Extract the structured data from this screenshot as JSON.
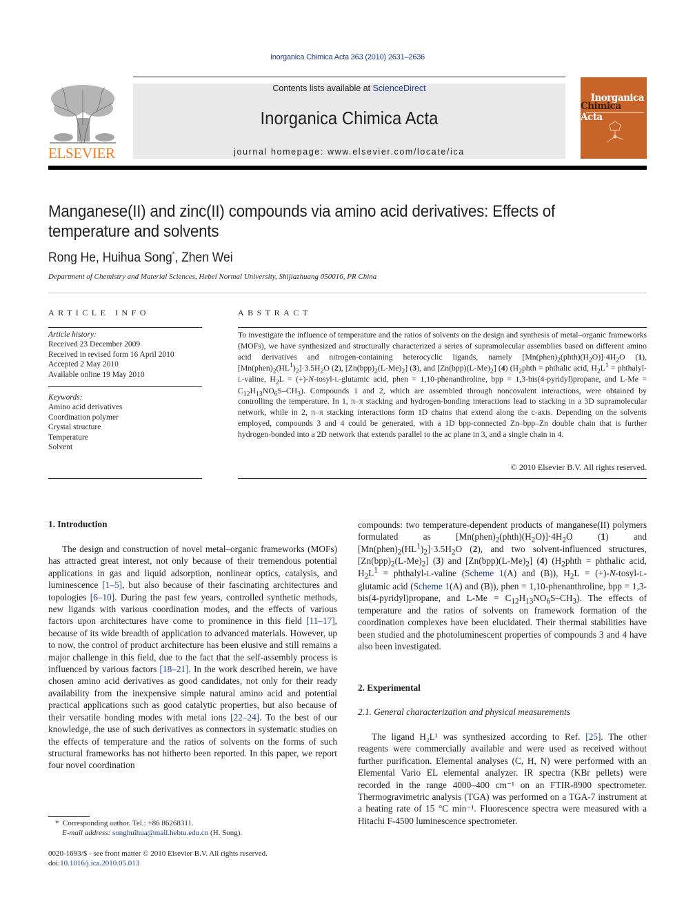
{
  "header": {
    "citation": "Inorganica Chimica Acta 363 (2010) 2631–2636",
    "contents_prefix": "Contents lists available at ",
    "contents_link": "ScienceDirect",
    "journal_name": "Inorganica Chimica Acta",
    "homepage": "journal homepage: www.elsevier.com/locate/ica",
    "publisher_logo_text": "ELSEVIER",
    "cover": {
      "line1": "Inorganica",
      "line2a": "Chimica",
      "line2b": " Acta",
      "color": "#c8632a"
    }
  },
  "article": {
    "title": "Manganese(II) and zinc(II) compounds via amino acid derivatives: Effects of temperature and solvents",
    "authors": {
      "a1": "Rong He, ",
      "a2": "Huihua Song",
      "a2_mark": "*",
      "a3": ", Zhen Wei"
    },
    "affiliation": "Department of Chemistry and Material Sciences, Hebei Normal University, Shijiazhuang 050016, PR China"
  },
  "article_info": {
    "heading": "ARTICLE INFO",
    "history_label": "Article history:",
    "history": [
      "Received 23 December 2009",
      "Received in revised form 16 April 2010",
      "Accepted 2 May 2010",
      "Available online 19 May 2010"
    ],
    "keywords_label": "Keywords:",
    "keywords": [
      "Amino acid derivatives",
      "Coordination polymer",
      "Crystal structure",
      "Temperature",
      "Solvent"
    ]
  },
  "abstract": {
    "heading": "ABSTRACT",
    "s1": "To investigate the influence of temperature and the ratios of solvents on the design and synthesis of metal–organic frameworks (MOFs), we have synthesized and structurally characterized a series of supramolecular assemblies based on different amino acid derivatives and nitrogen-containing heterocyclic ligands, namely ",
    "s2": "Compounds 1 and 2, which are assembled through noncovalent interactions, were obtained by controlling the temperature. In 1, π–π stacking and hydrogen-bonding interactions lead to stacking in a 3D supramolecular network, while in 2, π–π stacking interactions form 1D chains that extend along the c-axis. Depending on the solvents employed, compounds 3 and 4 could be generated, with a 1D bpp-connected Zn–bpp–Zn double chain that is further hydrogen-bonded into a 2D network that extends parallel to the ac plane in 3, and a single chain in 4.",
    "copyright": "© 2010 Elsevier B.V. All rights reserved."
  },
  "intro": {
    "heading": "1. Introduction",
    "p1a": "The design and construction of novel metal–organic frameworks (MOFs) has attracted great interest, not only because of their tremendous potential applications in gas and liquid adsorption, nonlinear optics, catalysis, and luminescence ",
    "ref1": "[1–5]",
    "p1b": ", but also because of their fascinating architectures and topologies ",
    "ref2": "[6–10]",
    "p1c": ". During the past few years, controlled synthetic methods, new ligands with various coordination modes, and the effects of various factors upon architectures have come to prominence in this field ",
    "ref3": "[11–17]",
    "p1d": ", because of its wide breadth of application to advanced materials. However, up to now, the control of product architecture has been elusive and still remains a major challenge in this field, due to the fact that the self-assembly process is influenced by various factors ",
    "ref4": "[18–21]",
    "p1e": ". In the work described herein, we have chosen amino acid derivatives as good candidates, not only for their ready availability from the inexpensive simple natural amino acid and potential practical applications such as good catalytic properties, but also because of their versatile bonding modes with metal ions ",
    "ref5": "[22–24]",
    "p1f": ". To the best of our knowledge, the use of such derivatives as connectors in systematic studies on the effects of temperature and the ratios of solvents on the forms of such structural frameworks has not hitherto been reported. In this paper, we report four novel coordination",
    "cont_a": "compounds: two temperature-dependent products of manganese(II) polymers formulated as ",
    "cont_scheme": "Scheme 1",
    "cont_end": ". The effects of temperature and the ratios of solvents on framework formation of the coordination complexes have been elucidated. Their thermal stabilities have been studied and the photoluminescent properties of compounds 3 and 4 have also been investigated."
  },
  "experimental": {
    "heading": "2. Experimental",
    "subheading": "2.1. General characterization and physical measurements",
    "p_a": "The ligand H₂L¹ was synthesized according to Ref. ",
    "ref": "[25]",
    "p_b": ". The other reagents were commercially available and were used as received without further purification. Elemental analyses (C, H, N) were performed with an Elemental Vario EL elemental analyzer. IR spectra (KBr pellets) were recorded in the range 4000–400 cm⁻¹ on an FTIR-8900 spectrometer. Thermogravimetric analysis (TGA) was performed on a TGA-7 instrument at a heating rate of 15 °C min⁻¹. Fluorescence spectra were measured with a Hitachi F-4500 luminescence spectrometer."
  },
  "footnote": {
    "mark": "*",
    "corresponding": "Corresponding author. Tel.: +86 86268311.",
    "email_label": "E-mail address: ",
    "email": "songhuihua@mail.hebtu.edu.cn",
    "email_suffix": " (H. Song).",
    "front_matter": "0020-1693/$ - see front matter © 2010 Elsevier B.V. All rights reserved.",
    "doi_label": "doi:",
    "doi": "10.1016/j.ica.2010.05.013"
  },
  "colors": {
    "link": "#1c3d8c",
    "elsevier_orange": "#f47a1f",
    "masthead_bg": "#e9e9e9"
  }
}
